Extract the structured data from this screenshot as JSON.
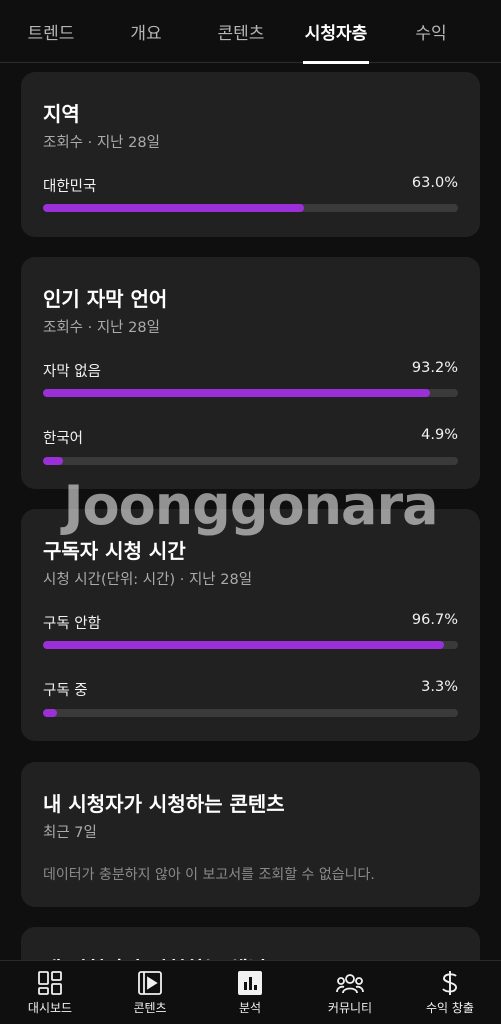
{
  "tabs": [
    {
      "label": "트렌드"
    },
    {
      "label": "개요"
    },
    {
      "label": "콘텐츠"
    },
    {
      "label": "시청자층"
    },
    {
      "label": "수익"
    }
  ],
  "active_tab": "시청자층",
  "region_card": {
    "title": "지역",
    "subtitle": "조회수 · 지난 28일",
    "rows": [
      {
        "label": "대한민국",
        "value": "63.0%",
        "percent": 63.0
      }
    ]
  },
  "subtitle_card": {
    "title": "인기 자막 언어",
    "subtitle": "조회수 · 지난 28일",
    "rows": [
      {
        "label": "자막 없음",
        "value": "93.2%",
        "percent": 93.2
      },
      {
        "label": "한국어",
        "value": "4.9%",
        "percent": 4.9
      }
    ]
  },
  "subscriber_card": {
    "title": "구독자 시청 시간",
    "subtitle": "시청 시간(단위: 시간) · 지난 28일",
    "rows": [
      {
        "label": "구독 안함",
        "value": "96.7%",
        "percent": 96.7
      },
      {
        "label": "구독 중",
        "value": "3.3%",
        "percent": 3.3
      }
    ]
  },
  "content_card": {
    "title": "내 시청자가 시청하는 콘텐츠",
    "subtitle": "최근 7일",
    "message": "데이터가 충분하지 않아 이 보고서를 조회할 수 없습니다."
  },
  "partial_card": {
    "title": "내 시청자가 시청하는 채널"
  },
  "watermark": "Joonggonara",
  "bottom_nav": [
    {
      "label": "대시보드",
      "icon": "dashboard-icon"
    },
    {
      "label": "콘텐츠",
      "icon": "content-icon"
    },
    {
      "label": "분석",
      "icon": "analytics-icon"
    },
    {
      "label": "커뮤니티",
      "icon": "community-icon"
    },
    {
      "label": "수익 창출",
      "icon": "earn-icon"
    }
  ],
  "colors": {
    "accent": "#9b30d9",
    "card": "#212121",
    "background": "#0f0f0f",
    "track": "#3a3a3a"
  }
}
